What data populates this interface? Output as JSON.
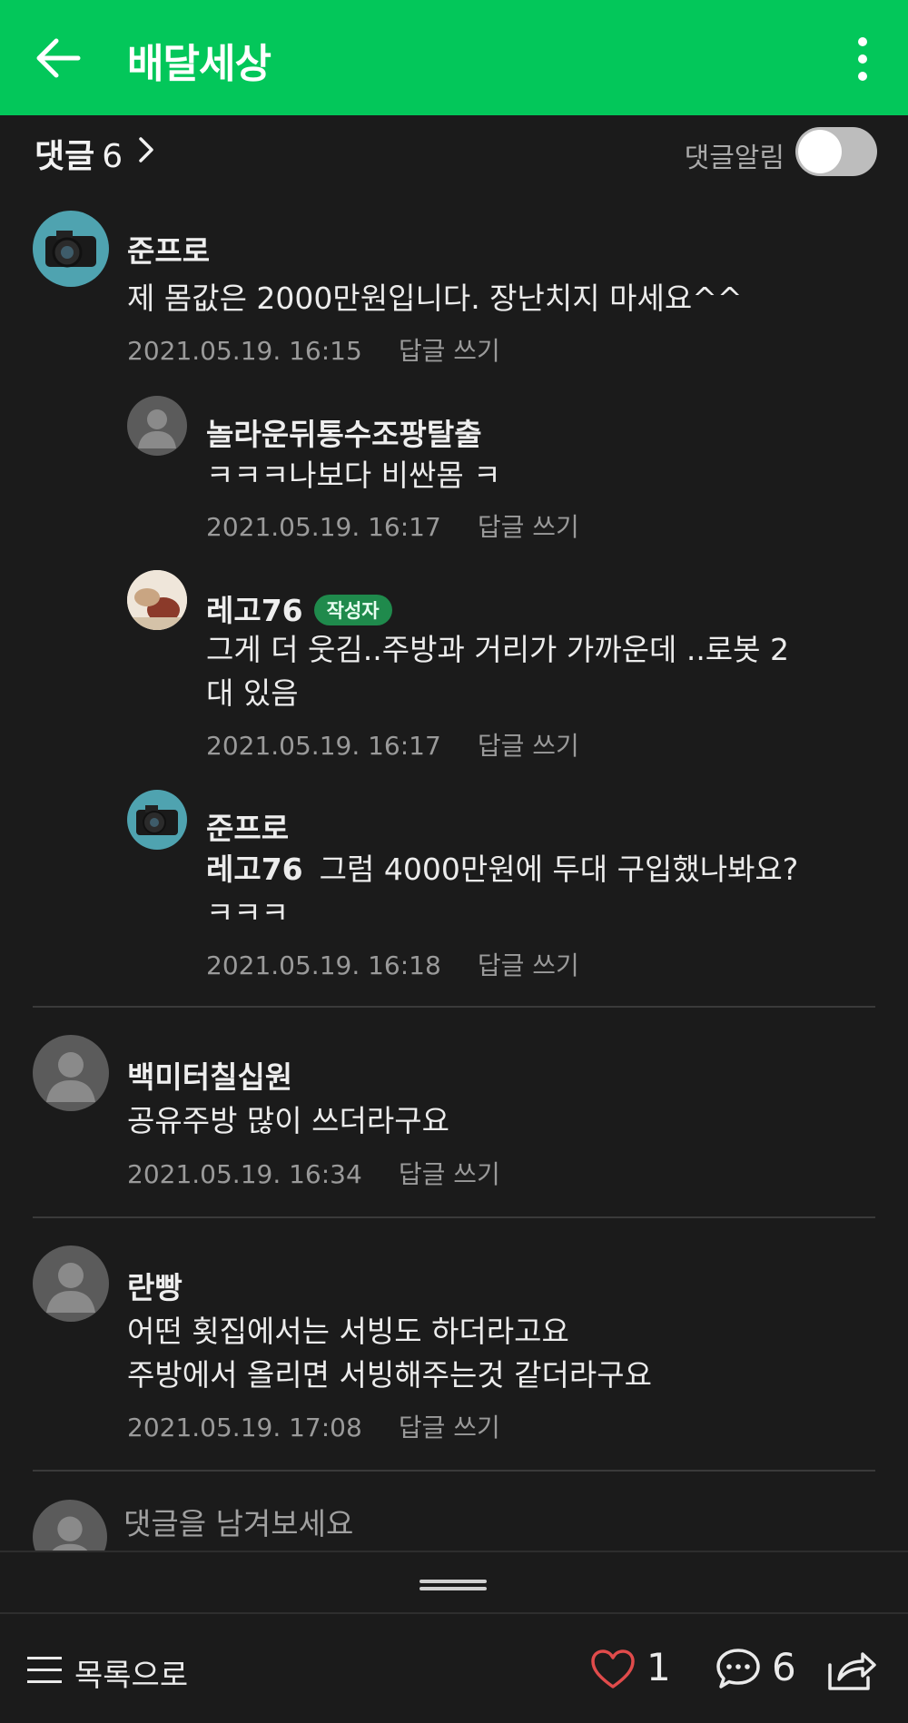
{
  "appbar": {
    "title": "배달세상"
  },
  "comments_header": {
    "label": "댓글",
    "count": "6",
    "notify_label": "댓글알림",
    "notify_on": false
  },
  "comments": [
    {
      "author": "준프로",
      "text": "제 몸값은 2000만원입니다. 장난치지 마세요^^",
      "date": "2021.05.19. 16:15",
      "reply": "답글 쓰기",
      "avatar": "camera-avatar"
    },
    {
      "author": "놀라운뒤통수조팡탈출",
      "text": "ㅋㅋㅋ나보다 비싼몸 ㅋ",
      "date": "2021.05.19. 16:17",
      "reply": "답글 쓰기",
      "avatar": "default-avatar"
    },
    {
      "author": "레고76",
      "badge": "작성자",
      "text_line1": "그게 더 웃김..주방과 거리가 가까운데 ..로봇 2",
      "text_line2": "대 있음",
      "date": "2021.05.19. 16:17",
      "reply": "답글 쓰기",
      "avatar": "photo-avatar"
    },
    {
      "author": "준프로",
      "mention": "레고76",
      "text_line1": "그럼 4000만원에 두대 구입했나봐요?",
      "text_line2": "ㅋㅋㅋ",
      "date": "2021.05.19. 16:18",
      "reply": "답글 쓰기",
      "avatar": "camera-avatar"
    },
    {
      "author": "백미터칠십원",
      "text": "공유주방 많이 쓰더라구요",
      "date": "2021.05.19. 16:34",
      "reply": "답글 쓰기",
      "avatar": "default-avatar"
    },
    {
      "author": "란빵",
      "text_line1": "어떤 횟집에서는 서빙도 하더라고요",
      "text_line2": "주방에서 올리면 서빙해주는것 같더라구요",
      "date": "2021.05.19. 17:08",
      "reply": "답글 쓰기",
      "avatar": "default-avatar"
    }
  ],
  "write": {
    "placeholder": "댓글을 남겨보세요"
  },
  "bottom_bar": {
    "list_label": "목록으로",
    "like_count": "1",
    "comment_count": "6"
  },
  "colors": {
    "brand": "#03c75a",
    "background": "#1b1b1b",
    "like": "#e04b4b",
    "badge": "#1f8a4c"
  }
}
